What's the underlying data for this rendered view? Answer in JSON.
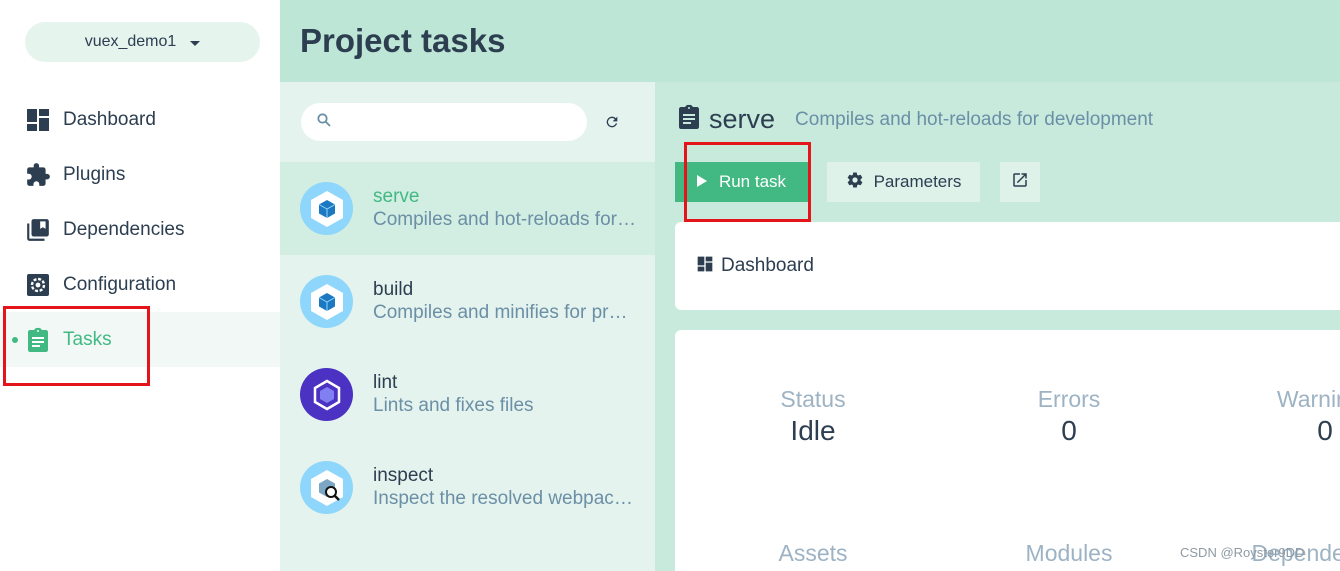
{
  "project": {
    "name": "vuex_demo1"
  },
  "nav": {
    "items": [
      {
        "label": "Dashboard",
        "icon": "dashboard-icon"
      },
      {
        "label": "Plugins",
        "icon": "puzzle-icon"
      },
      {
        "label": "Dependencies",
        "icon": "library-icon"
      },
      {
        "label": "Configuration",
        "icon": "settings-box-icon"
      },
      {
        "label": "Tasks",
        "icon": "clipboard-icon",
        "active": true
      }
    ]
  },
  "header": {
    "title": "Project tasks"
  },
  "search": {
    "placeholder": "",
    "value": ""
  },
  "tasks": [
    {
      "name": "serve",
      "description": "Compiles and hot-reloads for development",
      "icon": "webpack-icon",
      "selected": true
    },
    {
      "name": "build",
      "description": "Compiles and minifies for production",
      "icon": "webpack-icon"
    },
    {
      "name": "lint",
      "description": "Lints and fixes files",
      "icon": "eslint-icon"
    },
    {
      "name": "inspect",
      "description": "Inspect the resolved webpack config",
      "icon": "webpack-inspect-icon"
    }
  ],
  "detail": {
    "name": "serve",
    "description": "Compiles and hot-reloads for development",
    "run_label": "Run task",
    "params_label": "Parameters",
    "dashboard_label": "Dashboard",
    "stats": [
      {
        "label": "Status",
        "value": "Idle"
      },
      {
        "label": "Errors",
        "value": "0"
      },
      {
        "label": "Warnings",
        "value": "0"
      },
      {
        "label": "Assets",
        "value": ""
      },
      {
        "label": "Modules",
        "value": ""
      },
      {
        "label": "Dependencies",
        "value": ""
      }
    ]
  },
  "colors": {
    "accent": "#42b983",
    "header_bg": "#bde6d6",
    "annotation": "#e3141a"
  },
  "watermark": "CSDN @Royster9DD"
}
